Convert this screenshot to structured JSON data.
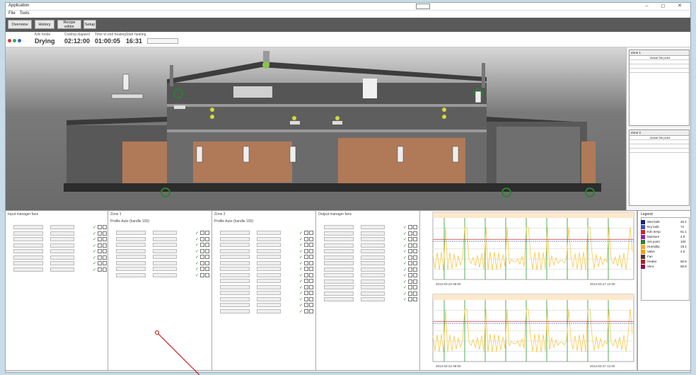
{
  "window": {
    "title": "Application",
    "menu": [
      "File",
      "Tools"
    ],
    "controls": "– ◻ ✕"
  },
  "toolbar": {
    "buttons": [
      "Overview",
      "History",
      "Recipe editor",
      "Setup"
    ]
  },
  "status": {
    "state_label": "Kiln mode",
    "state_value": "Drying",
    "t1_label": "Cooling elapsed",
    "t1_value": "02:12:00",
    "t2_label": "Time to end heating",
    "t2_value": "01:00:05",
    "t3_label": "Start heating",
    "t3_value": "16:31",
    "dots": [
      "#d33",
      "#3a6",
      "#36c"
    ]
  },
  "right_panel": {
    "panel1_title": "Zone 1",
    "panel2_title": "Zone 2",
    "table_header": "Actual Set point"
  },
  "panes": [
    {
      "title": "Input manager fans",
      "rows": 8
    },
    {
      "title": "Zone 1",
      "subtitle": "Profile  Auto (handle 100)",
      "rows": 8
    },
    {
      "title": "Zone 2",
      "subtitle": "Profile  Auto (handle 100)",
      "rows": 14
    },
    {
      "title": "Output manager fans",
      "rows": 13
    }
  ],
  "legend": {
    "title": "Legend",
    "items": [
      {
        "name": "Wet bulb",
        "value": "26.1",
        "color": "#1a237e"
      },
      {
        "name": "Dry bulb",
        "value": "72",
        "color": "#3f51b5"
      },
      {
        "name": "Kiln temp",
        "value": "61.1",
        "color": "#c62828"
      },
      {
        "name": "Moisture",
        "value": "4.0",
        "color": "#8e24aa"
      },
      {
        "name": "Set point",
        "value": "100",
        "color": "#2e7d32"
      },
      {
        "name": "Humidity",
        "value": "18.1",
        "color": "#f9a825"
      },
      {
        "name": "Valve",
        "value": "4.0",
        "color": "#ff9800"
      },
      {
        "name": "Fan",
        "value": "",
        "color": "#4e342e"
      },
      {
        "name": "Heater",
        "value": "66.8",
        "color": "#b71c1c"
      },
      {
        "name": "Vent",
        "value": "66.8",
        "color": "#880e4f"
      }
    ]
  },
  "chart1": {
    "xlabels": [
      "2013-03-22 08:00",
      "2013-03-27 12:00"
    ]
  },
  "chart2": {
    "xlabels": [
      "2013-03-22 08:00",
      "2013-03-27 12:00"
    ]
  }
}
